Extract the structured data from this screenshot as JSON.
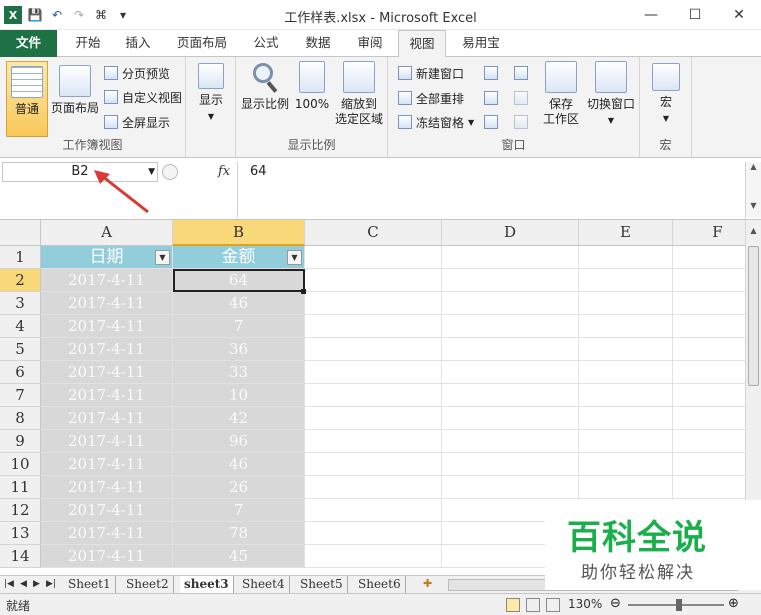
{
  "window": {
    "title": "工作样表.xlsx - Microsoft Excel",
    "minimize": "—",
    "maximize": "☐",
    "close": "✕"
  },
  "qat": [
    "💾",
    "↶",
    "↷",
    "⌘",
    "▾"
  ],
  "tabs": [
    "文件",
    "开始",
    "插入",
    "页面布局",
    "公式",
    "数据",
    "审阅",
    "视图",
    "易用宝"
  ],
  "ribbon": {
    "group1": {
      "label": "工作簿视图",
      "normal": "普通",
      "pagelayout": "页面布局",
      "pagebreak": "分页预览",
      "custom": "自定义视图",
      "fullscreen": "全屏显示"
    },
    "group2": {
      "show": "显示"
    },
    "group3": {
      "label": "显示比例",
      "zoom": "显示比例",
      "zoom100": "100%",
      "zoomsel": "缩放到\n选定区域"
    },
    "group4": {
      "label": "窗口",
      "newwin": "新建窗口",
      "arrange": "全部重排",
      "freeze": "冻结窗格",
      "save": "保存\n工作区",
      "switch": "切换窗口"
    },
    "group5": {
      "label": "宏",
      "macro": "宏"
    }
  },
  "formula_bar": {
    "name_box": "B2",
    "fx": "fx",
    "content": "64"
  },
  "columns": [
    "A",
    "B",
    "C",
    "D",
    "E",
    "F"
  ],
  "rows": [
    "1",
    "2",
    "3",
    "4",
    "5",
    "6",
    "7",
    "8",
    "9",
    "10",
    "11",
    "12",
    "13",
    "14"
  ],
  "table": {
    "headers": [
      "日期",
      "金额"
    ],
    "data": [
      [
        "2017-4-11",
        "64"
      ],
      [
        "2017-4-11",
        "46"
      ],
      [
        "2017-4-11",
        "7"
      ],
      [
        "2017-4-11",
        "36"
      ],
      [
        "2017-4-11",
        "33"
      ],
      [
        "2017-4-11",
        "10"
      ],
      [
        "2017-4-11",
        "42"
      ],
      [
        "2017-4-11",
        "96"
      ],
      [
        "2017-4-11",
        "46"
      ],
      [
        "2017-4-11",
        "26"
      ],
      [
        "2017-4-11",
        "7"
      ],
      [
        "2017-4-11",
        "78"
      ],
      [
        "2017-4-11",
        "45"
      ]
    ]
  },
  "sheets": [
    "Sheet1",
    "Sheet2",
    "sheet3",
    "Sheet4",
    "Sheet5",
    "Sheet6"
  ],
  "active_sheet": "sheet3",
  "status": {
    "ready": "就绪",
    "zoom": "130%"
  },
  "watermark": {
    "line1": "百科全说",
    "line2": "助你轻松解决"
  },
  "colors": {
    "file_tab": "#1e7145",
    "header_fill": "#92cddc",
    "data_fill": "#d8d8d8",
    "arrow": "#d93a36"
  }
}
